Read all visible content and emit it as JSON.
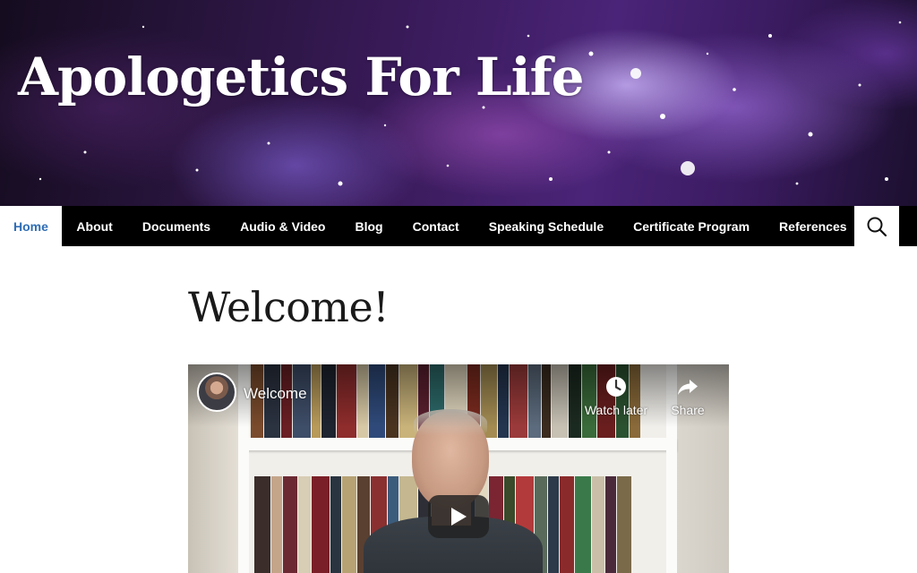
{
  "site": {
    "title": "Apologetics For Life"
  },
  "nav": {
    "items": [
      {
        "label": "Home",
        "active": true
      },
      {
        "label": "About"
      },
      {
        "label": "Documents"
      },
      {
        "label": "Audio & Video"
      },
      {
        "label": "Blog"
      },
      {
        "label": "Contact"
      },
      {
        "label": "Speaking Schedule"
      },
      {
        "label": "Certificate Program"
      },
      {
        "label": "References"
      }
    ],
    "search_icon": "search-icon"
  },
  "page": {
    "title": "Welcome!"
  },
  "video": {
    "title": "Welcome",
    "watch_later_label": "Watch later",
    "share_label": "Share",
    "icons": [
      "clock-icon",
      "share-arrow-icon",
      "play-icon"
    ]
  },
  "colors": {
    "nav_background": "#000000",
    "active_nav_text": "#2e6db5",
    "title_text": "#ffffff",
    "page_title_text": "#1a1a1a"
  }
}
